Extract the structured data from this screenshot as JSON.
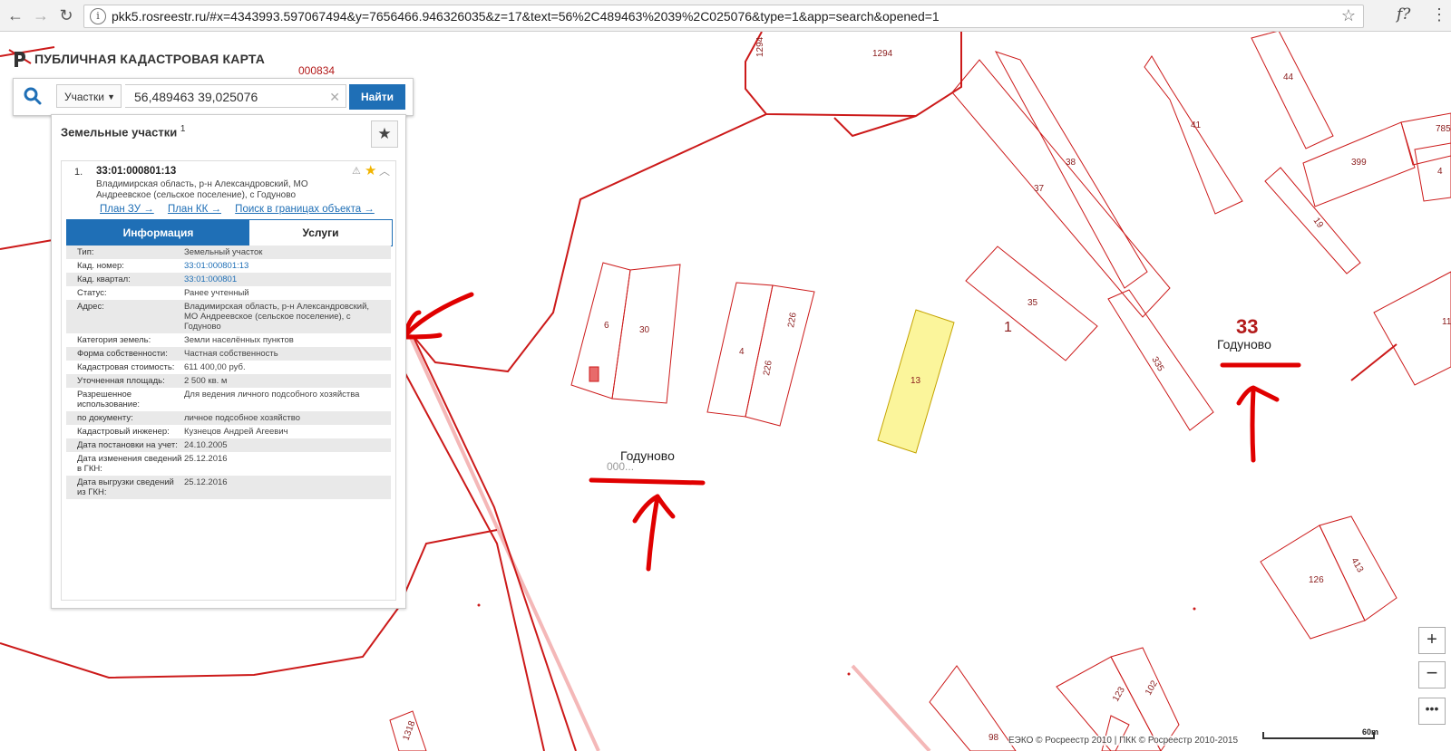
{
  "browser": {
    "url": "pkk5.rosreestr.ru/#x=4343993.597067494&y=7656466.946326035&z=17&text=56%2C489463%2039%2C025076&type=1&app=search&opened=1",
    "ext_label": "f?"
  },
  "app": {
    "title": "ПУБЛИЧНАЯ КАДАСТРОВАЯ КАРТА"
  },
  "search": {
    "type_value": "Участки",
    "query": "56,489463 39,025076",
    "find_label": "Найти"
  },
  "panel": {
    "title": "Земельные участки",
    "count": "1",
    "result": {
      "index": "1.",
      "cad_number": "33:01:000801:13",
      "address": "Владимирская область, р-н Александровский, МО Андреевское (сельское поселение), с Годуново",
      "links": [
        "План ЗУ →",
        "План КК →",
        "Поиск в границах объекта →"
      ],
      "tabs": {
        "info": "Информация",
        "services": "Услуги"
      },
      "rows": [
        {
          "k": "Тип:",
          "v": "Земельный участок"
        },
        {
          "k": "Кад. номер:",
          "v": "33:01:000801:13"
        },
        {
          "k": "Кад. квартал:",
          "v": "33:01:000801"
        },
        {
          "k": "Статус:",
          "v": "Ранее учтенный"
        },
        {
          "k": "Адрес:",
          "v": "Владимирская область, р-н Александровский, МО Андреевское (сельское поселение), с Годуново"
        },
        {
          "k": "Категория земель:",
          "v": "Земли населённых пунктов"
        },
        {
          "k": "Форма собственности:",
          "v": "Частная собственность"
        },
        {
          "k": "Кадастровая стоимость:",
          "v": "611 400,00 руб."
        },
        {
          "k": "Уточненная площадь:",
          "v": "2 500 кв. м"
        },
        {
          "k": "Разрешенное использование:",
          "v": "Для ведения личного подсобного хозяйства"
        },
        {
          "k": "по документу:",
          "v": "личное подсобное хозяйство"
        },
        {
          "k": "Кадастровый инженер:",
          "v": "Кузнецов Андрей Агеевич"
        },
        {
          "k": "Дата постановки на учет:",
          "v": "24.10.2005"
        },
        {
          "k": "Дата изменения сведений в ГКН:",
          "v": "25.12.2016"
        },
        {
          "k": "Дата выгрузки сведений из ГКН:",
          "v": "25.12.2016"
        }
      ]
    }
  },
  "map": {
    "quarter_label": "000834",
    "place_name_1": "Годуново",
    "place_name_2": "Годуново",
    "overlap_label": "000...",
    "region_code": "33",
    "region_code_2": "1",
    "parcels": [
      "1294",
      "1294",
      "44",
      "41",
      "785",
      "399",
      "38",
      "37",
      "19",
      "4",
      "35",
      "6",
      "30",
      "226",
      "4",
      "226",
      "13",
      "335",
      "11",
      "126",
      "413",
      "123",
      "102",
      "98",
      "1318"
    ],
    "attribution": "ЕЭКО © Росреестр 2010 | ПКК © Росреестр 2010-2015",
    "scale": "60m"
  },
  "colors": {
    "accent": "#1f6fb6",
    "parcel": "#cc1a1a",
    "selected": "#fbf59b",
    "annotation": "#e00000"
  }
}
